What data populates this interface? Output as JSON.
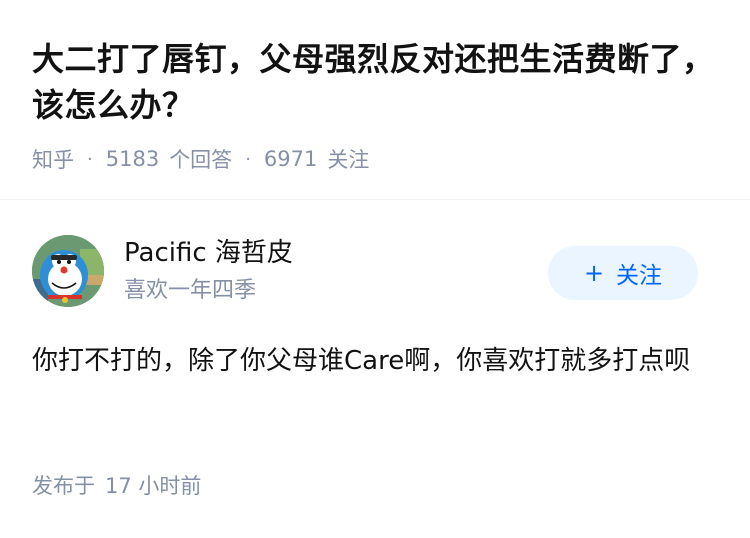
{
  "question": {
    "title": "大二打了唇钉，父母强烈反对还把生活费断了，该怎么办？",
    "source": "知乎",
    "separator": "·",
    "answer_count": "5183",
    "answer_label": "个回答",
    "follower_count": "6971",
    "follower_label": "关注"
  },
  "author": {
    "avatar_icon": "cartoon-doraemon-avatar",
    "name": "Pacific 海哲皮",
    "bio": "喜欢一年四季",
    "follow_plus": "+",
    "follow_label": "关注"
  },
  "answer": {
    "content": "你打不打的，除了你父母谁Care啊，你喜欢打就多打点呗",
    "published_label": "发布于",
    "published_time": "17 小时前"
  },
  "colors": {
    "primary_text": "#121212",
    "secondary_text": "#8590a6",
    "accent_blue": "#0066ff",
    "follow_bg": "#ebf5ff"
  }
}
